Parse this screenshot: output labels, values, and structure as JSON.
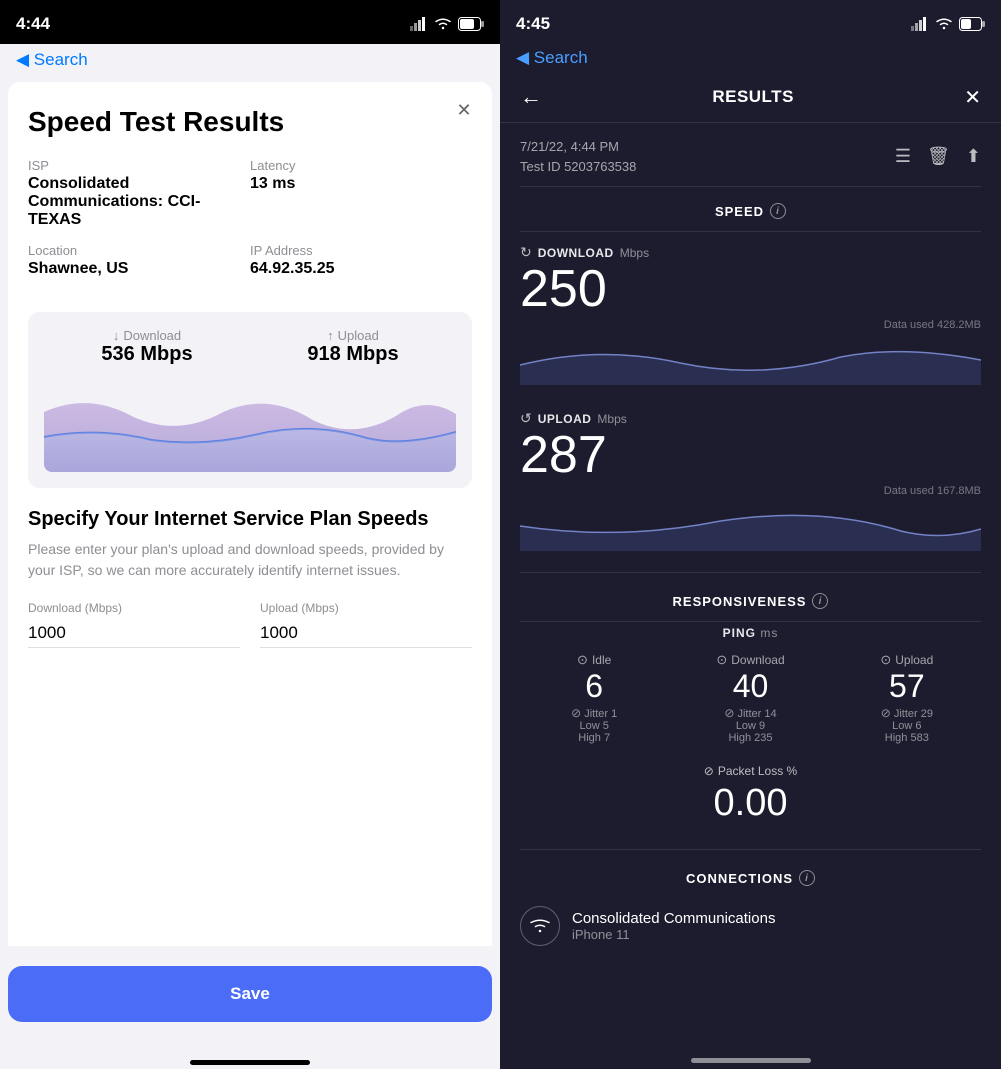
{
  "left": {
    "status_bar": {
      "time": "4:44",
      "back_label": "◀ Search"
    },
    "close_button": "✕",
    "title": "Speed Test Results",
    "info": {
      "isp_label": "ISP",
      "isp_value": "Consolidated Communications: CCI-TEXAS",
      "latency_label": "Latency",
      "latency_value": "13 ms",
      "location_label": "Location",
      "location_value": "Shawnee, US",
      "ip_label": "IP Address",
      "ip_value": "64.92.35.25"
    },
    "speed": {
      "download_label": "Download",
      "download_value": "536 Mbps",
      "upload_label": "Upload",
      "upload_value": "918 Mbps"
    },
    "isp_plan": {
      "title": "Specify Your Internet Service Plan Speeds",
      "description": "Please enter your plan's upload and download speeds, provided by your ISP, so we can more accurately identify internet issues.",
      "download_label": "Download (Mbps)",
      "download_value": "1000",
      "upload_label": "Upload (Mbps)",
      "upload_value": "1000"
    },
    "save_button": "Save"
  },
  "right": {
    "status_bar": {
      "time": "4:45",
      "back_label": "◀ Search"
    },
    "header": {
      "back_arrow": "←",
      "title": "RESULTS",
      "close": "✕"
    },
    "meta": {
      "date": "7/21/22, 4:44 PM",
      "test_id": "Test ID 5203763538"
    },
    "speed_section": {
      "label": "SPEED",
      "download_label": "DOWNLOAD",
      "download_unit": "Mbps",
      "download_value": "250",
      "download_data": "Data used 428.2MB",
      "upload_label": "UPLOAD",
      "upload_unit": "Mbps",
      "upload_value": "287",
      "upload_data": "Data used 167.8MB"
    },
    "responsiveness_section": {
      "label": "RESPONSIVENESS",
      "ping_label": "PING",
      "ping_unit": "ms",
      "idle_label": "Idle",
      "idle_value": "6",
      "idle_jitter_label": "Jitter 1",
      "idle_low": "Low 5",
      "idle_high": "High 7",
      "download_label": "Download",
      "download_value": "40",
      "download_jitter_label": "Jitter 14",
      "download_low": "Low 9",
      "download_high": "High 235",
      "upload_label": "Upload",
      "upload_value": "57",
      "upload_jitter_label": "Jitter 29",
      "upload_low": "Low 6",
      "upload_high": "High 583",
      "packet_loss_label": "Packet Loss %",
      "packet_loss_value": "0.00"
    },
    "connections_section": {
      "label": "CONNECTIONS",
      "isp_name": "Consolidated Communications",
      "device": "iPhone 11"
    }
  }
}
